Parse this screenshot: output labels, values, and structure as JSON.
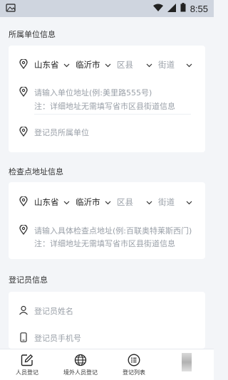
{
  "status_bar": {
    "time": "8:55"
  },
  "sections": {
    "unit": {
      "title": "所属单位信息",
      "province": "山东省",
      "city": "临沂市",
      "district": "区县",
      "street": "街道",
      "address_placeholder": "请输入单位地址(例:美里路555号)",
      "address_note": "注：详细地址无需填写省市区县街道信息",
      "unit_placeholder": "登记员所属单位"
    },
    "checkpoint": {
      "title": "检查点地址信息",
      "province": "山东省",
      "city": "临沂市",
      "district": "区县",
      "street": "街道",
      "address_placeholder": "请输入具体检查点地址(例:百联奥特莱斯西门)",
      "address_note": "注：详细地址无需填写省市区县街道信息"
    },
    "registrar": {
      "title": "登记员信息",
      "name_placeholder": "登记员姓名",
      "phone_placeholder": "登记员手机号"
    }
  },
  "tabbar": {
    "tabs": [
      {
        "label": "人员登记",
        "icon": "edit-icon"
      },
      {
        "label": "境外人员登记",
        "icon": "globe-icon"
      },
      {
        "label": "登记列表",
        "icon": "list-icon"
      }
    ]
  },
  "colors": {
    "background": "#f3f5f8",
    "card": "#ffffff",
    "muted_text": "#9aa0a8"
  }
}
